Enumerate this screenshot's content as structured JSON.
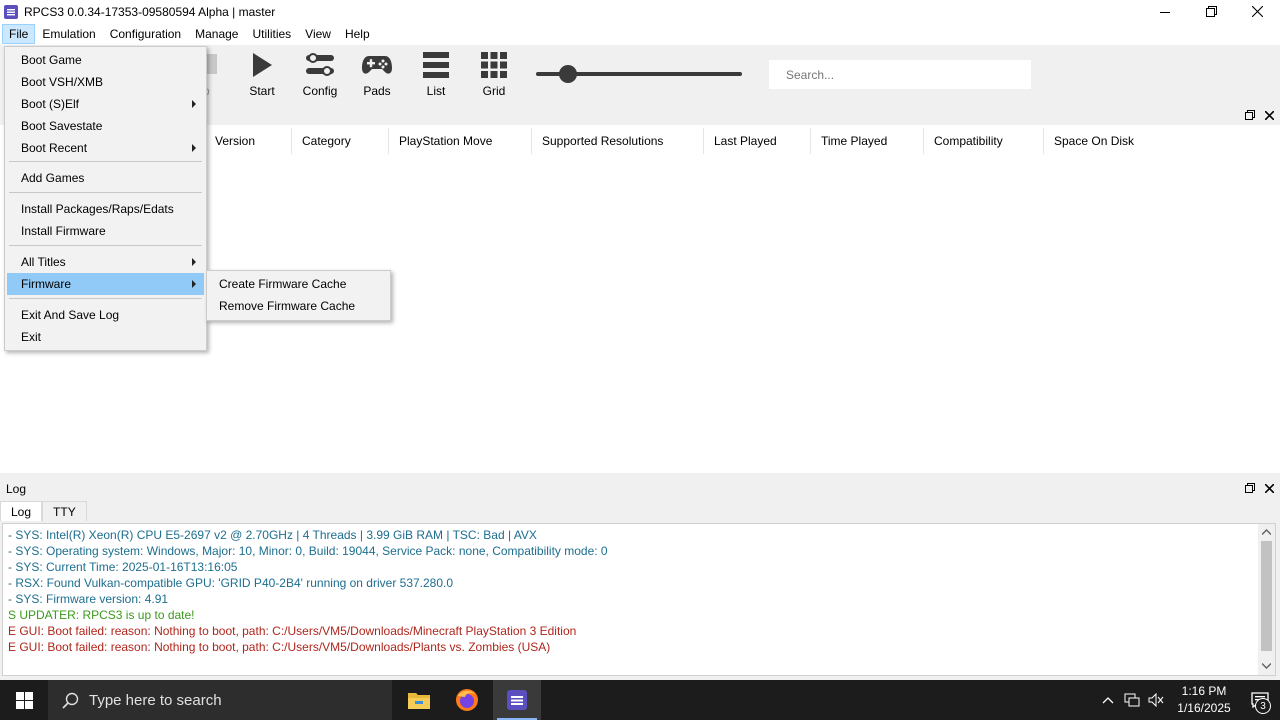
{
  "window": {
    "title": "RPCS3 0.0.34-17353-09580594 Alpha | master",
    "controls": [
      "minimize-icon",
      "maximize-icon",
      "close-icon"
    ]
  },
  "menubar": {
    "items": [
      "File",
      "Emulation",
      "Configuration",
      "Manage",
      "Utilities",
      "View",
      "Help"
    ],
    "active": "File"
  },
  "toolbar": {
    "ghost_label": "p",
    "buttons": [
      {
        "label": "Start",
        "icon": "play-icon"
      },
      {
        "label": "Config",
        "icon": "config-sliders-icon"
      },
      {
        "label": "Pads",
        "icon": "gamepad-icon"
      },
      {
        "label": "List",
        "icon": "list-icon"
      },
      {
        "label": "Grid",
        "icon": "grid-icon"
      }
    ],
    "search_placeholder": "Search...",
    "zoom_slider_value": 0.12
  },
  "game_list": {
    "columns": [
      "Version",
      "Category",
      "PlayStation Move",
      "Supported Resolutions",
      "Last Played",
      "Time Played",
      "Compatibility",
      "Space On Disk"
    ]
  },
  "file_menu": {
    "items": [
      {
        "label": "Boot Game",
        "submenu": false
      },
      {
        "label": "Boot VSH/XMB",
        "submenu": false
      },
      {
        "label": "Boot (S)Elf",
        "submenu": true
      },
      {
        "label": "Boot Savestate",
        "submenu": false
      },
      {
        "label": "Boot Recent",
        "submenu": true
      },
      {
        "label": "Add Games",
        "submenu": false
      },
      {
        "label": "Install Packages/Raps/Edats",
        "submenu": false
      },
      {
        "label": "Install Firmware",
        "submenu": false
      },
      {
        "label": "All Titles",
        "submenu": true
      },
      {
        "label": "Firmware",
        "submenu": true,
        "highlighted": true
      },
      {
        "label": "Exit And Save Log",
        "submenu": false
      },
      {
        "label": "Exit",
        "submenu": false
      }
    ]
  },
  "firmware_submenu": {
    "items": [
      "Create Firmware Cache",
      "Remove Firmware Cache"
    ]
  },
  "log": {
    "title": "Log",
    "tabs": [
      "Log",
      "TTY"
    ],
    "active_tab": "Log",
    "lines": [
      {
        "text": "- SYS: Intel(R) Xeon(R) CPU E5-2697 v2 @ 2.70GHz | 4 Threads | 3.99 GiB RAM | TSC: Bad | AVX",
        "level": "sys"
      },
      {
        "text": "- SYS: Operating system: Windows, Major: 10, Minor: 0, Build: 19044, Service Pack: none, Compatibility mode: 0",
        "level": "sys"
      },
      {
        "text": "- SYS: Current Time: 2025-01-16T13:16:05",
        "level": "sys"
      },
      {
        "text": "- RSX: Found Vulkan-compatible GPU: 'GRID P40-2B4' running on driver 537.280.0",
        "level": "sys"
      },
      {
        "text": "- SYS: Firmware version: 4.91",
        "level": "sys"
      },
      {
        "text": "S UPDATER: RPCS3 is up to date!",
        "level": "success"
      },
      {
        "text": "E GUI: Boot failed: reason: Nothing to boot, path: C:/Users/VM5/Downloads/Minecraft PlayStation 3 Edition",
        "level": "error"
      },
      {
        "text": "E GUI: Boot failed: reason: Nothing to boot, path: C:/Users/VM5/Downloads/Plants vs. Zombies (USA)",
        "level": "error"
      }
    ]
  },
  "taskbar": {
    "search_placeholder": "Type here to search",
    "apps": [
      "file-explorer-icon",
      "firefox-icon",
      "rpcs3-icon"
    ],
    "clock_time": "1:16 PM",
    "clock_date": "1/16/2025",
    "notification_count": "3"
  },
  "colors": {
    "menu_highlight": "#91c9f7",
    "log_sys": "#1d6e8f",
    "log_success": "#3a9a1c",
    "log_error": "#b0261c",
    "app_accent": "#5b4fbf"
  }
}
